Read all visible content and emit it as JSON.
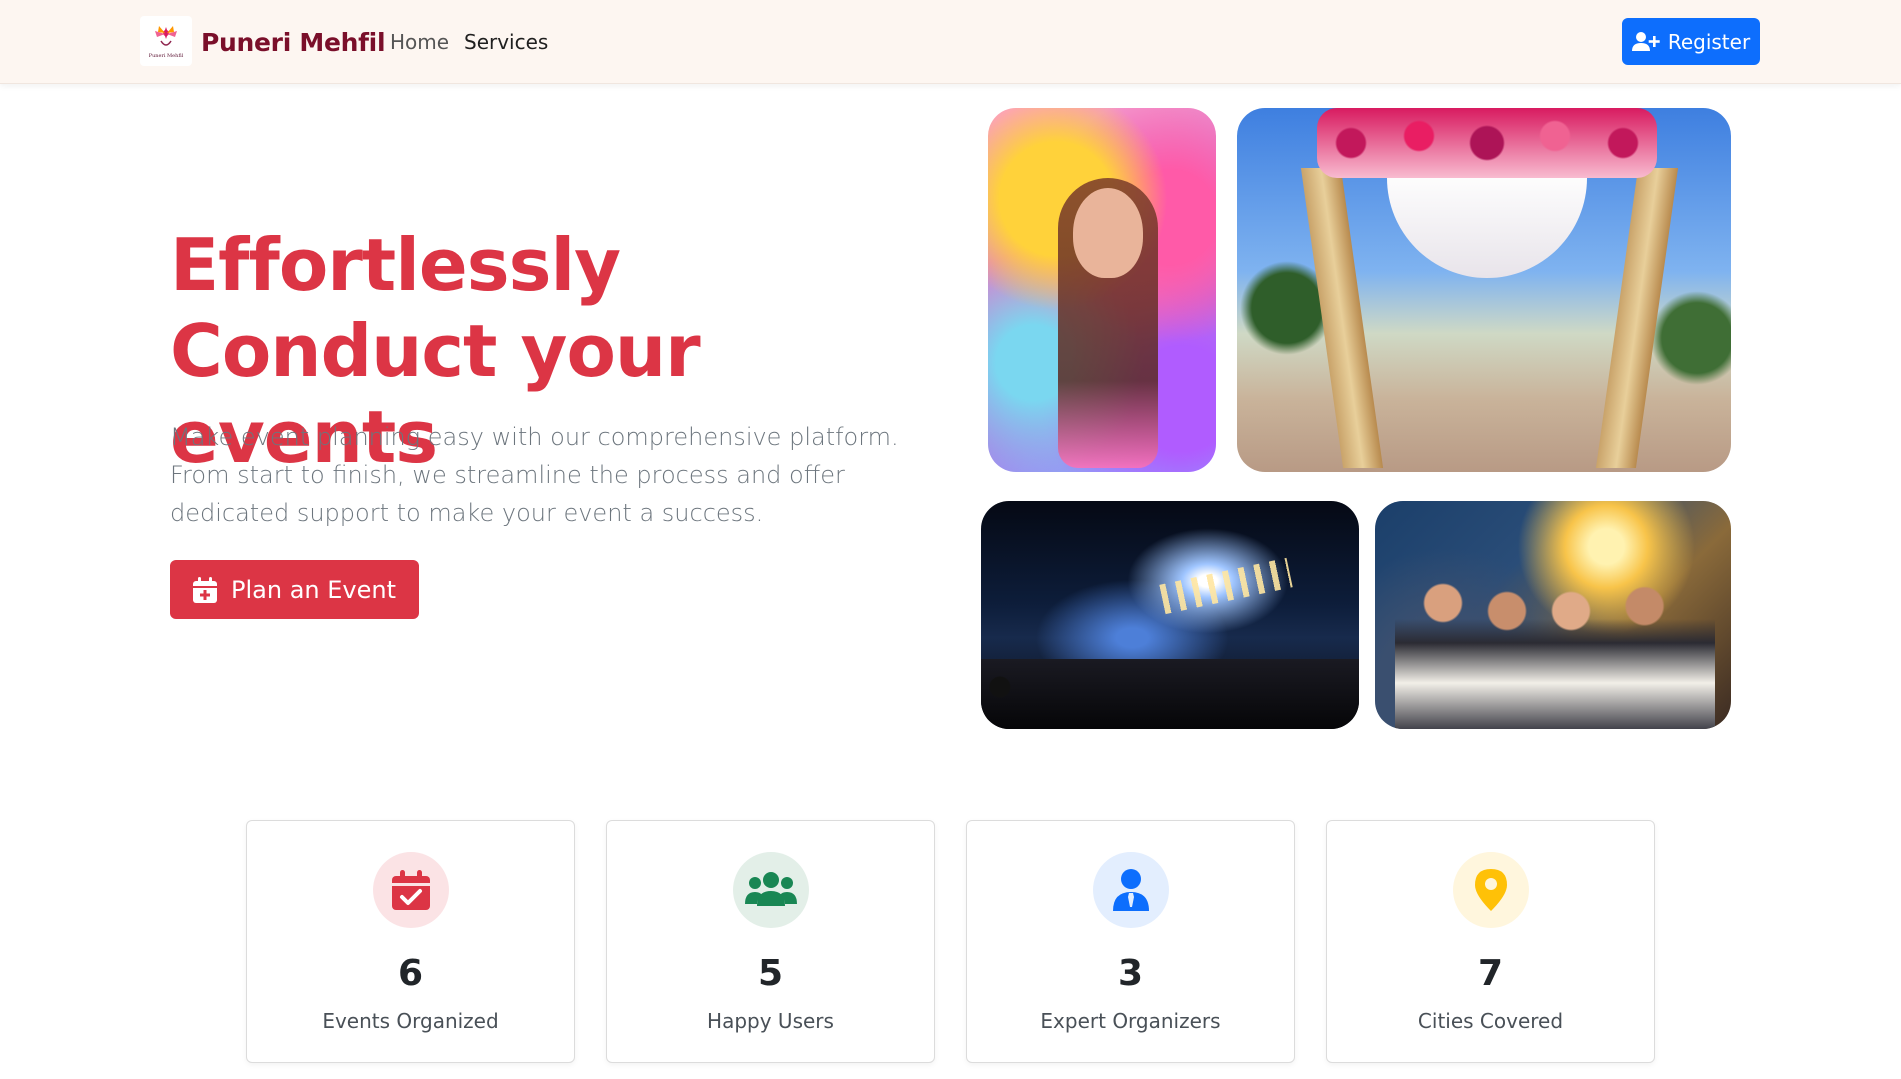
{
  "navbar": {
    "brand_name": "Puneri Mehfil",
    "logo_text": "Puneri Mehfil",
    "links": [
      {
        "label": "Home"
      },
      {
        "label": "Services"
      }
    ],
    "register_label": "Register",
    "register_icon": "user-plus-icon"
  },
  "hero": {
    "title": "Effortlessly Conduct your events",
    "subtitle": "Make event planning easy with our comprehensive platform. From start to finish, we streamline the process and offer dedicated support to make your event a success.",
    "cta_label": "Plan an Event",
    "cta_icon": "calendar-plus-icon"
  },
  "gallery": [
    {
      "name": "holi-photo"
    },
    {
      "name": "wedding-mandap-photo"
    },
    {
      "name": "concert-photo"
    },
    {
      "name": "party-photo"
    }
  ],
  "stats": [
    {
      "value": "6",
      "label": "Events Organized",
      "icon": "calendar-check-icon",
      "color": "#dc3545",
      "bg": "#fbe3e5"
    },
    {
      "value": "5",
      "label": "Happy Users",
      "icon": "users-icon",
      "color": "#198754",
      "bg": "#e3efe8"
    },
    {
      "value": "3",
      "label": "Expert Organizers",
      "icon": "user-tie-icon",
      "color": "#0d6efd",
      "bg": "#e3eefe"
    },
    {
      "value": "7",
      "label": "Cities Covered",
      "icon": "map-pin-icon",
      "color": "#ffc107",
      "bg": "#fff6dd"
    }
  ],
  "colors": {
    "accent_red": "#dc3545",
    "brand": "#7a0f2a",
    "primary_blue": "#0d6efd",
    "navbar_bg": "#fdf6f1"
  }
}
